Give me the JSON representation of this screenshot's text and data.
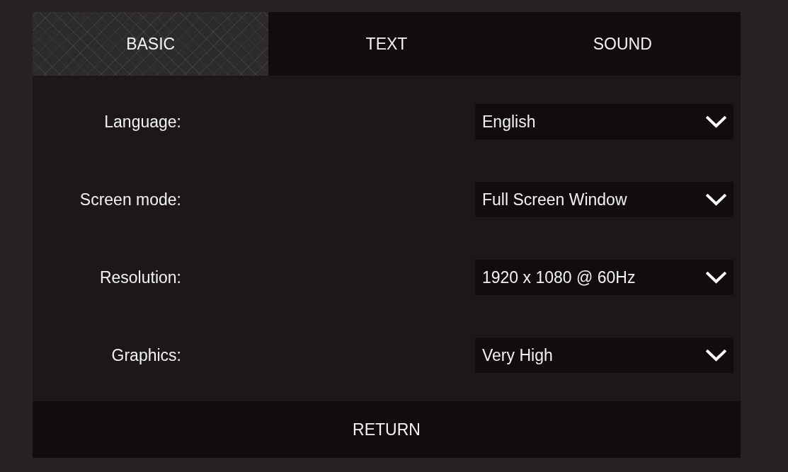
{
  "tabs": [
    {
      "label": "BASIC",
      "selected": true
    },
    {
      "label": "TEXT",
      "selected": false
    },
    {
      "label": "SOUND",
      "selected": false
    }
  ],
  "settings": [
    {
      "label": "Language:",
      "value": "English"
    },
    {
      "label": "Screen mode:",
      "value": "Full Screen Window"
    },
    {
      "label": "Resolution:",
      "value": "1920 x 1080 @ 60Hz"
    },
    {
      "label": "Graphics:",
      "value": "Very High"
    }
  ],
  "return_button": {
    "label": "RETURN"
  }
}
